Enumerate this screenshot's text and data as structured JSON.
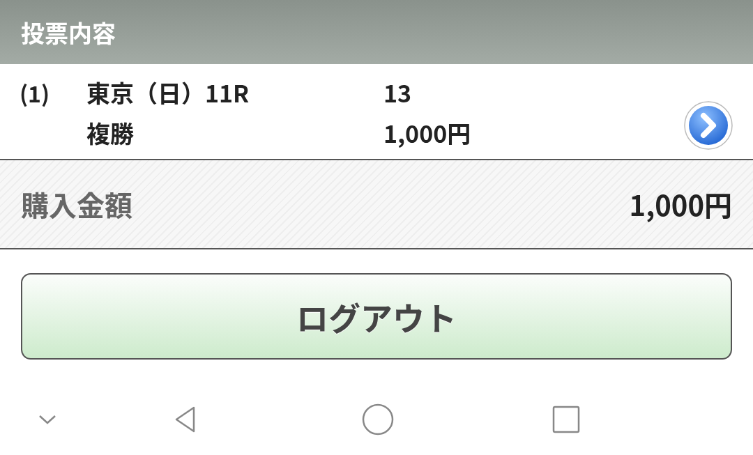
{
  "header": {
    "title": "投票内容"
  },
  "bets": [
    {
      "number": "(1)",
      "race": "東京（日）11R",
      "selection": "13",
      "bet_type": "複勝",
      "amount": "1,000円"
    }
  ],
  "total": {
    "label": "購入金額",
    "amount": "1,000円"
  },
  "logout_button": {
    "label": "ログアウト"
  }
}
